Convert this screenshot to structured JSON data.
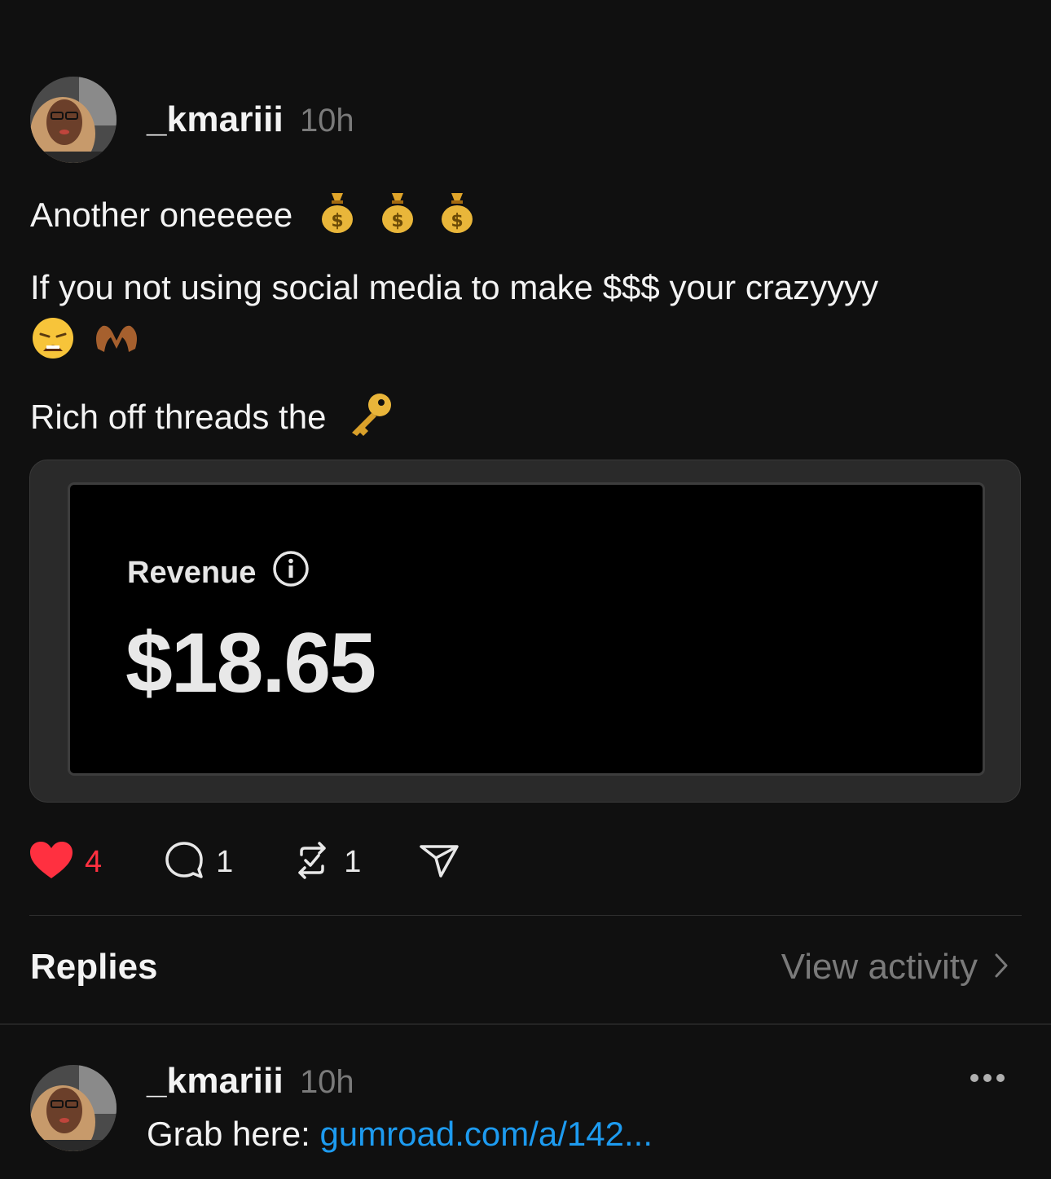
{
  "post": {
    "username": "_kmariii",
    "time": "10h",
    "line1": "Another oneeeee",
    "line2": "If you not using social media to make $$$ your crazyyyy",
    "line3": "Rich off threads the",
    "emoji_icons": [
      "money-bag-icon",
      "money-bag-icon",
      "money-bag-icon",
      "weary-face-icon",
      "heart-hands-icon",
      "key-icon"
    ]
  },
  "media": {
    "label": "Revenue",
    "amount": "$18.65"
  },
  "actions": {
    "likes": "4",
    "replies": "1",
    "reposts": "1"
  },
  "replies_section": {
    "title": "Replies",
    "view_activity": "View activity"
  },
  "reply": {
    "username": "_kmariii",
    "time": "10h",
    "text_prefix": "Grab here: ",
    "link": "gumroad.com/a/142..."
  },
  "colors": {
    "background": "#101010",
    "like_red": "#ff3040",
    "link_blue": "#1d9bf0",
    "muted_gray": "#7a7a7a"
  }
}
